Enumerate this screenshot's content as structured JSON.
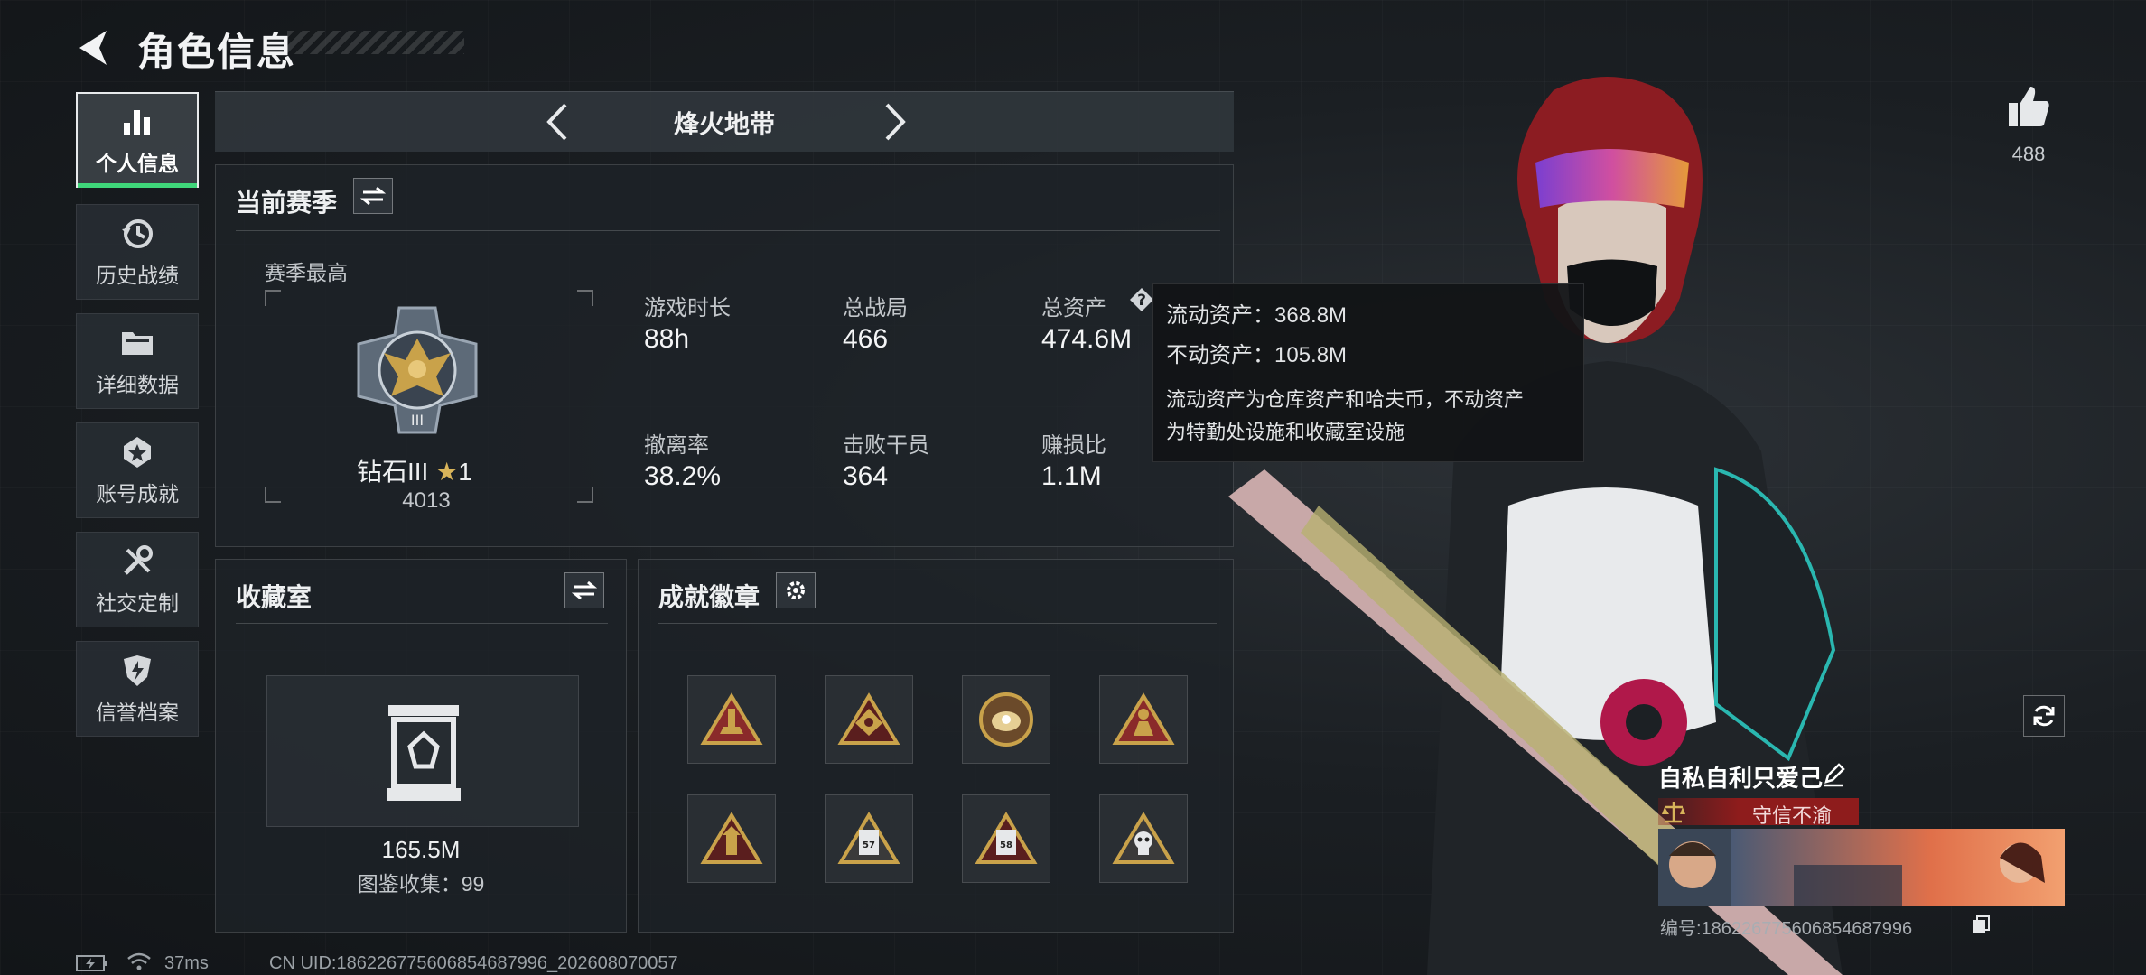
{
  "header": {
    "title": "角色信息"
  },
  "sidebar": {
    "items": [
      {
        "label": "个人信息",
        "icon": "bar-chart-icon",
        "active": true
      },
      {
        "label": "历史战绩",
        "icon": "history-clock-icon",
        "active": false
      },
      {
        "label": "详细数据",
        "icon": "folder-icon",
        "active": false
      },
      {
        "label": "账号成就",
        "icon": "achievement-icon",
        "active": false
      },
      {
        "label": "社交定制",
        "icon": "tools-icon",
        "active": false
      },
      {
        "label": "信誉档案",
        "icon": "shield-icon",
        "active": false
      }
    ]
  },
  "mode": {
    "title": "烽火地带"
  },
  "season": {
    "title": "当前赛季",
    "best_label": "赛季最高",
    "rank_name": "钻石III",
    "rank_stars": "1",
    "rank_points": "4013",
    "stats": [
      {
        "label": "游戏时长",
        "value": "88h"
      },
      {
        "label": "总战局",
        "value": "466"
      },
      {
        "label": "总资产",
        "value": "474.6M"
      },
      {
        "label": "撤离率",
        "value": "38.2%"
      },
      {
        "label": "击败干员",
        "value": "364"
      },
      {
        "label": "赚损比",
        "value": "1.1M"
      }
    ]
  },
  "tooltip": {
    "line1": "流动资产：368.8M",
    "line2": "不动资产：105.8M",
    "desc1": "流动资产为仓库资产和哈夫币，不动资产",
    "desc2": "为特勤处设施和收藏室设施"
  },
  "collection": {
    "title": "收藏室",
    "value": "165.5M",
    "catalog": "图鉴收集：99"
  },
  "badges": {
    "title": "成就徽章",
    "items": [
      {
        "icon": "rocket-badge-icon",
        "number": ""
      },
      {
        "icon": "eye-badge-icon",
        "number": ""
      },
      {
        "icon": "oyster-badge-icon",
        "number": ""
      },
      {
        "icon": "figure-badge-icon",
        "number": ""
      },
      {
        "icon": "tower-badge-icon",
        "number": ""
      },
      {
        "icon": "card-badge-icon",
        "number": "57"
      },
      {
        "icon": "card-badge-icon",
        "number": "58"
      },
      {
        "icon": "skull-badge-icon",
        "number": ""
      }
    ]
  },
  "profile": {
    "likes": "488",
    "name": "自私自利只爱己",
    "credit": "守信不渝",
    "uid_label": "编号:1862267756068546879​96"
  },
  "footer": {
    "ping": "37ms",
    "uid": "CN UID:18622677560685468​7996_202608070057"
  },
  "colors": {
    "accent_green": "#3fd67a",
    "credit_red": "#8e1c1c",
    "badge_gold": "#c9a24a"
  }
}
